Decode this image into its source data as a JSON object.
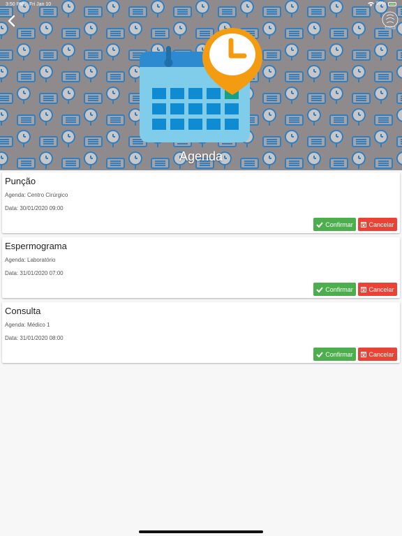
{
  "status_bar": {
    "time": "3:50 PM",
    "date": "Fri Jan 10",
    "battery": "99%"
  },
  "header": {
    "title": "Agenda"
  },
  "appointments": [
    {
      "title": "Punção",
      "agenda": "Agenda: Centro Cirúrgico",
      "data": "Data: 30/01/2020 09:00"
    },
    {
      "title": "Espermograma",
      "agenda": "Agenda: Laboratório",
      "data": "Data: 31/01/2020 07:00"
    },
    {
      "title": "Consulta",
      "agenda": "Agenda: Médico 1",
      "data": "Data: 31/01/2020 08:00"
    }
  ],
  "buttons": {
    "confirm": "Confirmar",
    "cancel": "Cancelar"
  },
  "colors": {
    "confirm": "#4cae4c",
    "cancel": "#ea4335",
    "header_bg": "#8f8a8c",
    "calendar": "#7fcdea",
    "pin": "#f39c12"
  }
}
